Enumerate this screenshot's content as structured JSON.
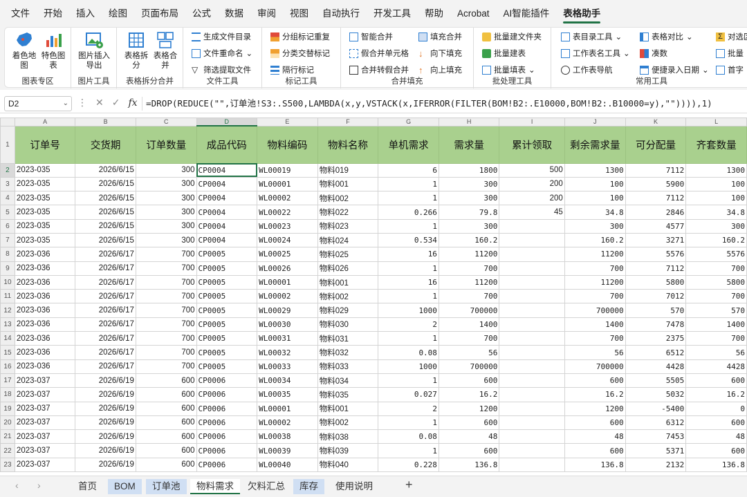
{
  "menu": [
    "文件",
    "开始",
    "插入",
    "绘图",
    "页面布局",
    "公式",
    "数据",
    "审阅",
    "视图",
    "自动执行",
    "开发工具",
    "帮助",
    "Acrobat",
    "AI智能插件",
    "表格助手"
  ],
  "ribbon": {
    "groups": [
      "图表专区",
      "图片工具",
      "表格拆分合并",
      "文件工具",
      "标记工具",
      "合并填充",
      "批处理工具",
      "常用工具"
    ],
    "big": [
      "着色地图",
      "特色图表",
      "图片插入导出",
      "表格拆分",
      "表格合并"
    ],
    "file_tools": [
      "生成文件目录",
      "文件重命名",
      "筛选提取文件"
    ],
    "mark_tools": [
      "分组标记重复",
      "分类交替标记",
      "隔行标记"
    ],
    "merge_tools": [
      "智能合并",
      "填充合并",
      "假合并单元格",
      "向下填充",
      "合并转假合并",
      "向上填充"
    ],
    "batch_tools": [
      "批量建文件夹",
      "批量建表",
      "批量填表"
    ],
    "common_tools": [
      "表目录工具",
      "表格对比",
      "对选区",
      "工作表名工具",
      "凑数",
      "批量",
      "工作表导航",
      "便捷录入日期",
      "首字"
    ]
  },
  "formula_bar": {
    "cell": "D2",
    "formula": "=DROP(REDUCE(\"\",订单池!S3:.S500,LAMBDA(x,y,VSTACK(x,IFERROR(FILTER(BOM!B2:.E10000,BOM!B2:.B10000=y),\"\")))),1)"
  },
  "columns": [
    "A",
    "B",
    "C",
    "D",
    "E",
    "F",
    "G",
    "H",
    "I",
    "J",
    "K",
    "L"
  ],
  "headers": [
    "订单号",
    "交货期",
    "订单数量",
    "成品代码",
    "物料编码",
    "物料名称",
    "单机需求",
    "需求量",
    "累计领取",
    "剩余需求量",
    "可分配量",
    "齐套数量"
  ],
  "rows": [
    [
      "2023-035",
      "2026/6/15",
      "300",
      "CP0004",
      "WL00019",
      "物料019",
      "6",
      "1800",
      "500",
      "1300",
      "7112",
      "1300"
    ],
    [
      "2023-035",
      "2026/6/15",
      "300",
      "CP0004",
      "WL00001",
      "物料001",
      "1",
      "300",
      "200",
      "100",
      "5900",
      "100"
    ],
    [
      "2023-035",
      "2026/6/15",
      "300",
      "CP0004",
      "WL00002",
      "物料002",
      "1",
      "300",
      "200",
      "100",
      "7112",
      "100"
    ],
    [
      "2023-035",
      "2026/6/15",
      "300",
      "CP0004",
      "WL00022",
      "物料022",
      "0.266",
      "79.8",
      "45",
      "34.8",
      "2846",
      "34.8"
    ],
    [
      "2023-035",
      "2026/6/15",
      "300",
      "CP0004",
      "WL00023",
      "物料023",
      "1",
      "300",
      "",
      "300",
      "4577",
      "300"
    ],
    [
      "2023-035",
      "2026/6/15",
      "300",
      "CP0004",
      "WL00024",
      "物料024",
      "0.534",
      "160.2",
      "",
      "160.2",
      "3271",
      "160.2"
    ],
    [
      "2023-036",
      "2026/6/17",
      "700",
      "CP0005",
      "WL00025",
      "物料025",
      "16",
      "11200",
      "",
      "11200",
      "5576",
      "5576"
    ],
    [
      "2023-036",
      "2026/6/17",
      "700",
      "CP0005",
      "WL00026",
      "物料026",
      "1",
      "700",
      "",
      "700",
      "7112",
      "700"
    ],
    [
      "2023-036",
      "2026/6/17",
      "700",
      "CP0005",
      "WL00001",
      "物料001",
      "16",
      "11200",
      "",
      "11200",
      "5800",
      "5800"
    ],
    [
      "2023-036",
      "2026/6/17",
      "700",
      "CP0005",
      "WL00002",
      "物料002",
      "1",
      "700",
      "",
      "700",
      "7012",
      "700"
    ],
    [
      "2023-036",
      "2026/6/17",
      "700",
      "CP0005",
      "WL00029",
      "物料029",
      "1000",
      "700000",
      "",
      "700000",
      "570",
      "570"
    ],
    [
      "2023-036",
      "2026/6/17",
      "700",
      "CP0005",
      "WL00030",
      "物料030",
      "2",
      "1400",
      "",
      "1400",
      "7478",
      "1400"
    ],
    [
      "2023-036",
      "2026/6/17",
      "700",
      "CP0005",
      "WL00031",
      "物料031",
      "1",
      "700",
      "",
      "700",
      "2375",
      "700"
    ],
    [
      "2023-036",
      "2026/6/17",
      "700",
      "CP0005",
      "WL00032",
      "物料032",
      "0.08",
      "56",
      "",
      "56",
      "6512",
      "56"
    ],
    [
      "2023-036",
      "2026/6/17",
      "700",
      "CP0005",
      "WL00033",
      "物料033",
      "1000",
      "700000",
      "",
      "700000",
      "4428",
      "4428"
    ],
    [
      "2023-037",
      "2026/6/19",
      "600",
      "CP0006",
      "WL00034",
      "物料034",
      "1",
      "600",
      "",
      "600",
      "5505",
      "600"
    ],
    [
      "2023-037",
      "2026/6/19",
      "600",
      "CP0006",
      "WL00035",
      "物料035",
      "0.027",
      "16.2",
      "",
      "16.2",
      "5032",
      "16.2"
    ],
    [
      "2023-037",
      "2026/6/19",
      "600",
      "CP0006",
      "WL00001",
      "物料001",
      "2",
      "1200",
      "",
      "1200",
      "-5400",
      "0"
    ],
    [
      "2023-037",
      "2026/6/19",
      "600",
      "CP0006",
      "WL00002",
      "物料002",
      "1",
      "600",
      "",
      "600",
      "6312",
      "600"
    ],
    [
      "2023-037",
      "2026/6/19",
      "600",
      "CP0006",
      "WL00038",
      "物料038",
      "0.08",
      "48",
      "",
      "48",
      "7453",
      "48"
    ],
    [
      "2023-037",
      "2026/6/19",
      "600",
      "CP0006",
      "WL00039",
      "物料039",
      "1",
      "600",
      "",
      "600",
      "5371",
      "600"
    ],
    [
      "2023-037",
      "2026/6/19",
      "600",
      "CP0006",
      "WL00040",
      "物料040",
      "0.228",
      "136.8",
      "",
      "136.8",
      "2132",
      "136.8"
    ]
  ],
  "sheet_tabs": [
    "首页",
    "BOM",
    "订单池",
    "物料需求",
    "欠料汇总",
    "库存",
    "使用说明"
  ],
  "active_tab": "物料需求"
}
